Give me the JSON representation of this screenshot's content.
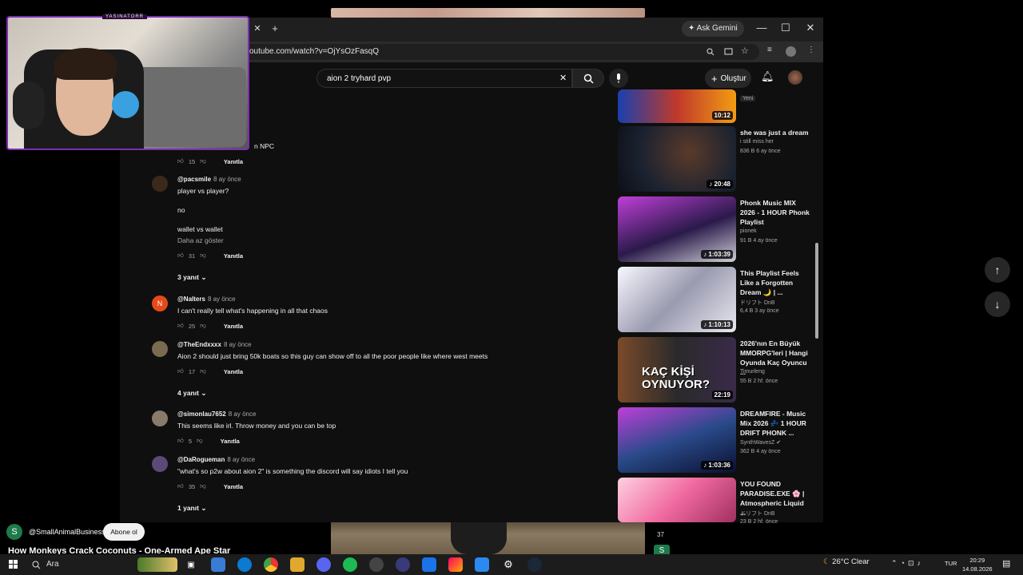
{
  "browser": {
    "url": "outube.com/watch?v=OjYsOzFasqQ",
    "gemini_label": "Ask Gemini"
  },
  "youtube": {
    "search_value": "aion 2 tryhard pvp",
    "create_label": "Oluştur"
  },
  "comments": [
    {
      "partial_text": "n NPC",
      "likes": "15",
      "reply_label": "Yanıtla"
    },
    {
      "author": "@pacsmile",
      "time": "8 ay önce",
      "lines": [
        "player vs player?",
        "no",
        "wallet vs wallet"
      ],
      "show_less": "Daha az göster",
      "likes": "31",
      "reply_label": "Yanıtla",
      "replies": "3 yanıt",
      "avatar_color": "#3b2a1c"
    },
    {
      "author": "@Nalters",
      "time": "8 ay önce",
      "text": "I can't really tell what's happening in all that chaos",
      "likes": "25",
      "reply_label": "Yanıtla",
      "avatar_letter": "N",
      "avatar_color": "#e64a19"
    },
    {
      "author": "@TheEndxxxx",
      "time": "8 ay önce",
      "text": "Aion 2 should just bring 50k boats so this guy can show off to all the poor people like where west meets",
      "likes": "17",
      "reply_label": "Yanıtla",
      "replies": "4 yanıt",
      "avatar_color": "#7a6a50"
    },
    {
      "author": "@simonlau7652",
      "time": "8 ay önce",
      "text": "This seems like irl. Throw money and you can be top",
      "likes": "5",
      "reply_label": "Yanıtla",
      "avatar_color": "#8a7a6a"
    },
    {
      "author": "@DaRogueman",
      "time": "8 ay önce",
      "text": "\"what's so p2w about aion 2\" is something the discord will say idiots I tell you",
      "likes": "35",
      "reply_label": "Yanıtla",
      "replies": "1 yanıt",
      "avatar_color": "#5a4a7a"
    }
  ],
  "recommendations": [
    {
      "badge": "Yeni",
      "duration": "10:12",
      "colors": [
        "#1a3fae",
        "#c0392b",
        "#f39c12"
      ]
    },
    {
      "title": "she was just a dream",
      "channel": "i still miss her",
      "meta": "836 B   6 ay önce",
      "duration": "20:48",
      "colors": [
        "#1b2230",
        "#5a3a2a",
        "#0d0f18"
      ]
    },
    {
      "title": "Phonk Music MIX 2026 - 1 HOUR Phonk Playlist",
      "channel": "pionek",
      "meta": "91 B   4 ay önce",
      "duration": "1:03:39",
      "colors": [
        "#c03fd8",
        "#2a1a4a",
        "#f0f0f0"
      ]
    },
    {
      "title": "This Playlist Feels Like a Forgotten Dream 🌙 | ...",
      "channel": "ドリフト DnB",
      "meta": "6,4 B   3 ay önce",
      "duration": "1:10:13",
      "colors": [
        "#e8e8f0",
        "#9a9ab0",
        "#f8f8ff"
      ]
    },
    {
      "title": "2026'nın En Büyük MMORPG'leri | Hangi Oyunda Kaç Oyuncu ...",
      "channel": "Timurleng",
      "meta": "55 B   2 hf. önce",
      "duration": "22:19",
      "thumb_text": "KAÇ KİŞİ OYNUYOR?",
      "colors": [
        "#2a2a2a",
        "#7a4a2a",
        "#f1c40f"
      ]
    },
    {
      "title": "DREAMFIRE - Music Mix 2026 💤 1 HOUR DRIFT PHONK ...",
      "channel": "SynthWavesZ",
      "meta": "362 B   4 ay önce",
      "duration": "1:03:36",
      "colors": [
        "#c03fd8",
        "#2a4a8a",
        "#0a1030"
      ]
    },
    {
      "title": "YOU FOUND PARADISE.EXE 🌸 | Atmospheric Liquid ...",
      "channel": "ドリフト DnB",
      "meta": "23 B   2 hf. önce",
      "colors": [
        "#f06aa0",
        "#ffd0e0",
        "#a03060"
      ]
    }
  ],
  "webcam": {
    "streamer_name": "YASINATORR"
  },
  "short": {
    "avatar_letter": "S",
    "handle": "@SmallAnimalBusiness",
    "subscribe_label": "Abone ol",
    "title": "How Monkeys Crack Coconuts - One-Armed Ape Star",
    "count": "37",
    "channel_letter": "S"
  },
  "taskbar": {
    "search_label": "Ara",
    "weather": "26°C  Clear",
    "language": "TUR",
    "time": "20:29",
    "date": "14.08.2026"
  }
}
